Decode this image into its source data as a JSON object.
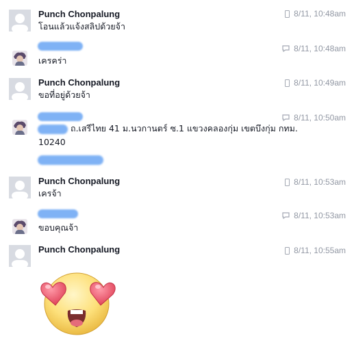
{
  "conversation": {
    "messages": [
      {
        "sender": "Punch Chonpalung",
        "text": "โอนแล้วแจ้งสลิปด้วยจ้า",
        "time": "8/11, 10:48am",
        "device": "phone-icon"
      },
      {
        "sender": "",
        "text": "เครคร่า",
        "time": "8/11, 10:48am",
        "device": "chat-icon"
      },
      {
        "sender": "Punch Chonpalung",
        "text": "ขอที่อยู่ด้วยจ้า",
        "time": "8/11, 10:49am",
        "device": "phone-icon"
      },
      {
        "sender": "",
        "text": "ถ.เสรีไทย 41 ม.นวกานตร์ ซ.1 แขวงคลองกุ่ม เขตบึงกุ่ม กทม.",
        "text2": "10240",
        "time": "8/11, 10:50am",
        "device": "chat-icon"
      },
      {
        "sender": "Punch Chonpalung",
        "text": "เครจ้า",
        "time": "8/11, 10:53am",
        "device": "phone-icon"
      },
      {
        "sender": "",
        "text": "ขอบคุณจ้า",
        "time": "8/11, 10:53am",
        "device": "chat-icon"
      },
      {
        "sender": "Punch Chonpalung",
        "text": "",
        "time": "8/11, 10:55am",
        "device": "phone-icon",
        "sticker": "heart-eyes-emoji"
      }
    ]
  },
  "colors": {
    "redaction": "#7fb2f5",
    "meta_text": "#9197a3",
    "avatar_placeholder": "#d8dbe2"
  }
}
